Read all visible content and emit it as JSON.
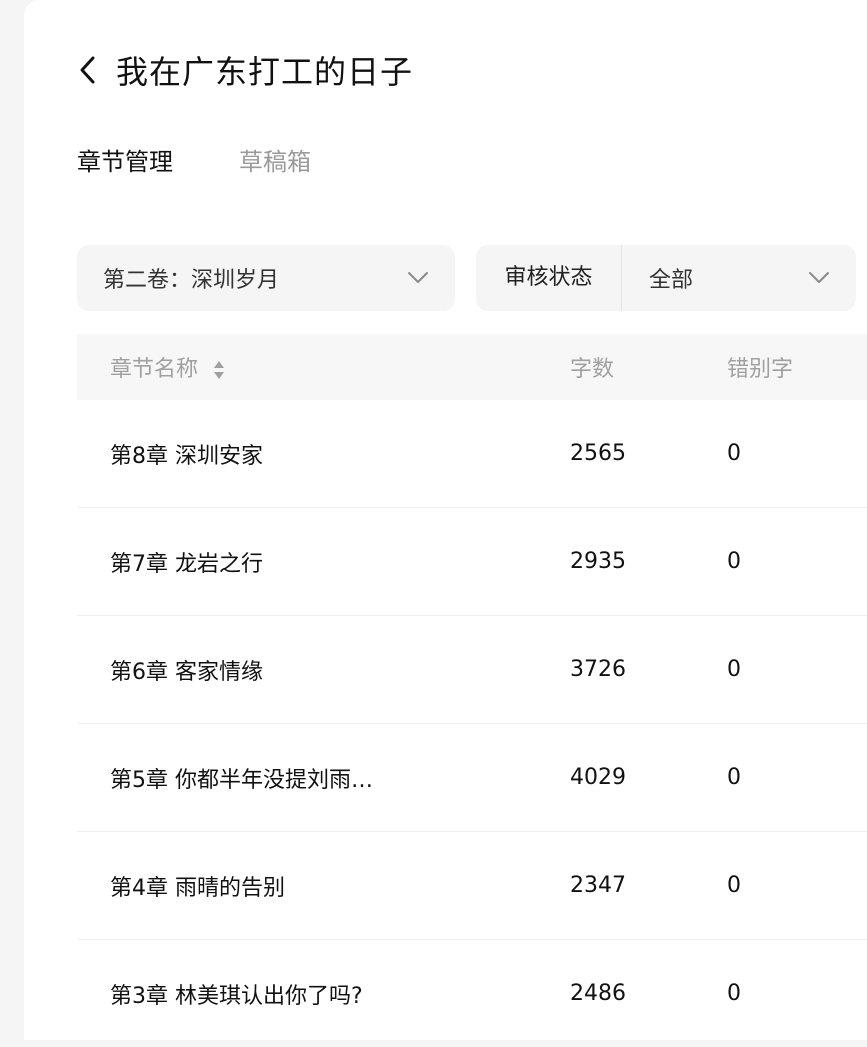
{
  "header": {
    "back_icon": "chevron-left-icon",
    "title": "我在广东打工的日子"
  },
  "tabs": [
    {
      "label": "章节管理",
      "active": true
    },
    {
      "label": "草稿箱",
      "active": false
    }
  ],
  "filters": {
    "volume": {
      "value": "第二卷：深圳岁月",
      "icon": "chevron-down-icon"
    },
    "status": {
      "label": "审核状态",
      "value": "全部",
      "icon": "chevron-down-icon"
    }
  },
  "table": {
    "columns": {
      "name": "章节名称",
      "words": "字数",
      "typos": "错别字"
    },
    "rows": [
      {
        "name": "第8章 深圳安家",
        "words": "2565",
        "typos": "0"
      },
      {
        "name": "第7章 龙岩之行",
        "words": "2935",
        "typos": "0"
      },
      {
        "name": "第6章 客家情缘",
        "words": "3726",
        "typos": "0"
      },
      {
        "name": "第5章 你都半年没提刘雨…",
        "words": "4029",
        "typos": "0"
      },
      {
        "name": "第4章 雨晴的告别",
        "words": "2347",
        "typos": "0"
      },
      {
        "name": "第3章 林美琪认出你了吗?",
        "words": "2486",
        "typos": "0"
      }
    ]
  },
  "colors": {
    "background": "#f5f5f5",
    "panel": "#ffffff",
    "text_primary": "#111111",
    "text_muted": "#9a9a9a"
  }
}
